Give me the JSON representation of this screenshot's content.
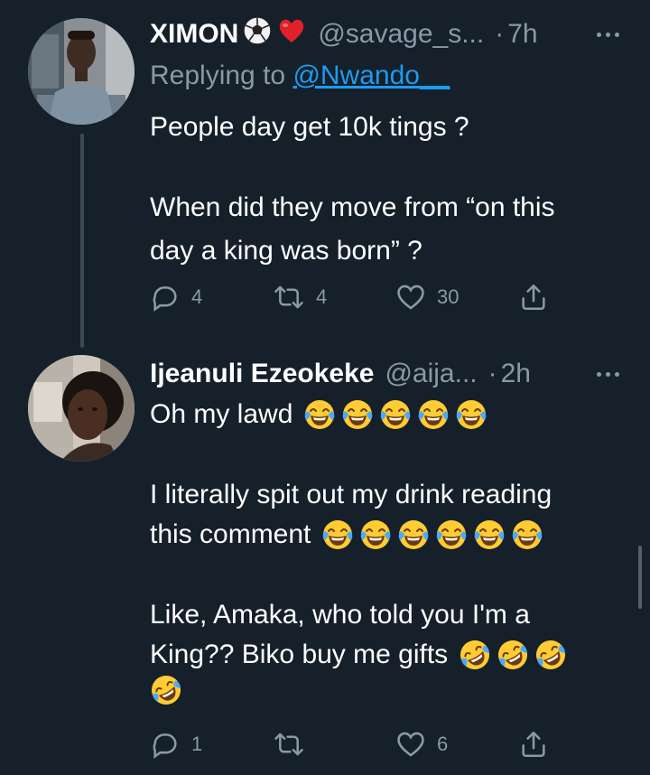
{
  "tweets": [
    {
      "name": "XIMON",
      "name_badges": [
        "soccer-ball-emoji",
        "red-heart-emoji"
      ],
      "handle": "@savage_s...",
      "separator": "·",
      "time": "7h",
      "replying_prefix": "Replying to",
      "replying_mention": "@Nwando__",
      "lines": [
        "People day get 10k tings ?",
        "When did they move from “on this",
        "day a king was born” ?"
      ],
      "replies": "4",
      "retweets": "4",
      "likes": "30"
    },
    {
      "name": "Ijeanuli Ezeokeke",
      "handle": "@aija...",
      "separator": "·",
      "time": "2h",
      "lines": [
        "Oh my lawd",
        "I literally spit out my drink reading",
        "this comment",
        "Like, Amaka, who told you I'm a",
        "King?? Biko buy me gifts"
      ],
      "emoji_runs": {
        "line1": {
          "icon": "face-with-tears-of-joy-emoji",
          "count": 5
        },
        "line3": {
          "icon": "face-with-tears-of-joy-emoji",
          "count": 6
        },
        "line5": {
          "icon": "rolling-on-the-floor-laughing-emoji",
          "count": 3
        },
        "line6": {
          "icon": "rolling-on-the-floor-laughing-emoji",
          "count": 1
        }
      },
      "replies": "1",
      "retweets": "",
      "likes": "6"
    }
  ],
  "icons": {
    "reply": "reply-icon",
    "retweet": "retweet-icon",
    "like": "heart-icon",
    "share": "share-icon",
    "more": "more-options-icon"
  },
  "colors": {
    "background": "#15202b",
    "text": "#ffffff",
    "secondary": "#8b98a5",
    "link": "#1d9bf0",
    "thread_line": "#3d4a56"
  }
}
